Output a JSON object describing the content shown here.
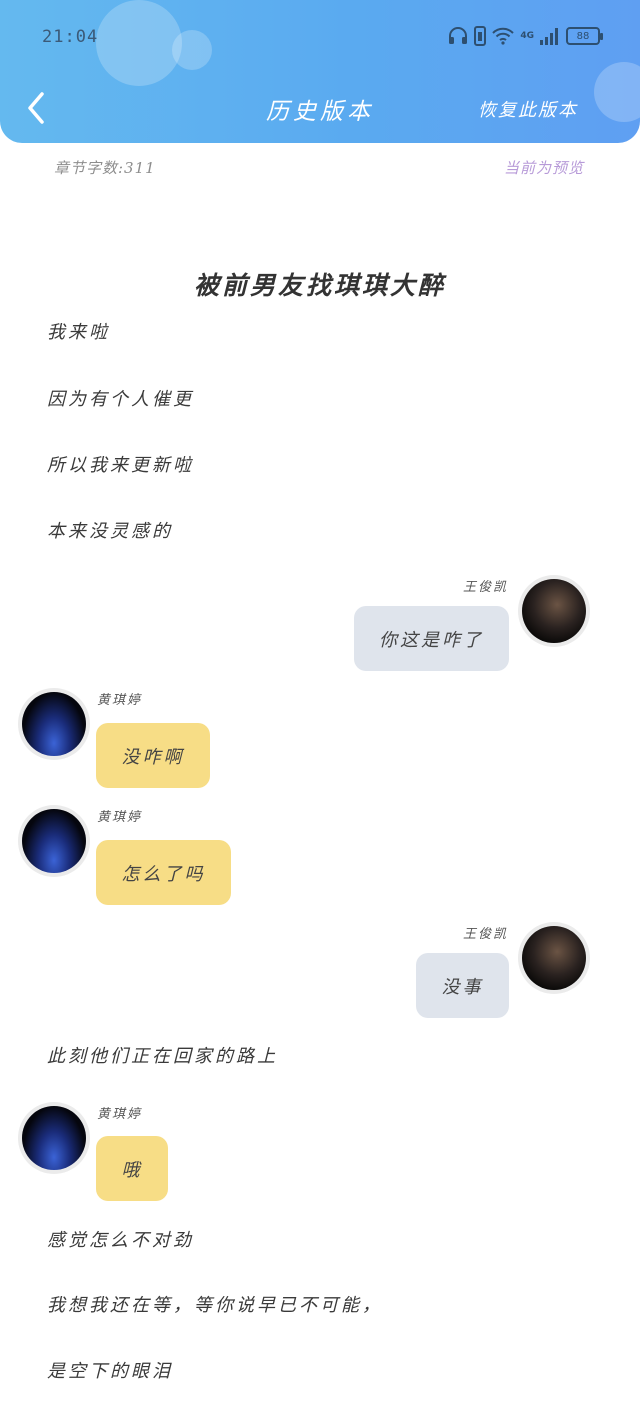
{
  "status_bar": {
    "time": "21:04",
    "network": "4G",
    "battery": "88"
  },
  "nav": {
    "title": "历史版本",
    "restore_label": "恢复此版本"
  },
  "info": {
    "word_count": "章节字数:311",
    "preview_note": "当前为预览"
  },
  "chapter": {
    "title": "被前男友找琪琪大醉",
    "narration": [
      "我来啦",
      "因为有个人催更",
      "所以我来更新啦",
      "本来没灵感的",
      "此刻他们正在回家的路上",
      "感觉怎么不对劲",
      "我想我还在等，等你说早已不可能，",
      "是空下的眼泪"
    ],
    "messages": [
      {
        "sender": "王俊凯",
        "side": "right",
        "text": "你这是咋了"
      },
      {
        "sender": "黄琪婷",
        "side": "left",
        "text": "没咋啊"
      },
      {
        "sender": "黄琪婷",
        "side": "left",
        "text": "怎么了吗"
      },
      {
        "sender": "王俊凯",
        "side": "right",
        "text": "没事"
      },
      {
        "sender": "黄琪婷",
        "side": "left",
        "text": "哦"
      }
    ]
  },
  "colors": {
    "header_gradient_start": "#64b9ef",
    "header_gradient_end": "#5f9ff2",
    "bubble_self": "#dfe4ec",
    "bubble_other": "#f7dd86",
    "preview_accent": "#b79ad8"
  },
  "icons": [
    "back-arrow-icon",
    "headphones-icon",
    "vibrate-icon",
    "wifi-icon",
    "signal-icon",
    "battery-icon"
  ]
}
